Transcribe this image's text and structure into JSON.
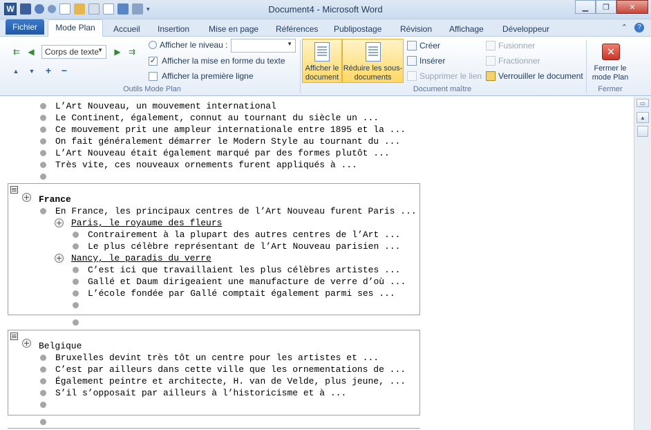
{
  "window": {
    "title": "Document4 - Microsoft Word"
  },
  "tabs": {
    "file": "Fichier",
    "active": "Mode Plan",
    "others": [
      "Accueil",
      "Insertion",
      "Mise en page",
      "Références",
      "Publipostage",
      "Révision",
      "Affichage",
      "Développeur"
    ]
  },
  "ribbon": {
    "outline_tools": {
      "label": "Outils Mode Plan",
      "level_select": "Corps de texte",
      "show_level_label": "Afficher le niveau :",
      "show_text_formatting": "Afficher la mise en forme du texte",
      "show_first_line": "Afficher la première ligne"
    },
    "master_document": {
      "label": "Document maître",
      "show_document": "Afficher le document",
      "collapse_subdocuments": "Réduire les sous-documents",
      "create": "Créer",
      "insert": "Insérer",
      "unlink": "Supprimer le lien",
      "merge": "Fusionner",
      "split": "Fractionner",
      "lock_document": "Verrouiller le document"
    },
    "close": {
      "label": "Fermer",
      "close_outline": "Fermer le mode Plan"
    }
  },
  "document": {
    "intro": [
      "L’Art Nouveau, un mouvement international",
      "Le Continent, également, connut au tournant du siècle un ...",
      "Ce mouvement prit une ampleur internationale entre 1895 et la ...",
      "On fait généralement démarrer le Modern Style au tournant du ...",
      "L’Art Nouveau était également marqué par des formes plutôt ...",
      "Très vite, ces nouveaux ornements furent appliqués à ..."
    ],
    "france": {
      "heading": "France",
      "intro": "En France, les principaux centres de l’Art Nouveau furent Paris ...",
      "paris": {
        "heading": "Paris, le royaume des fleurs",
        "items": [
          "Contrairement à la plupart des autres centres de l’Art ...",
          "Le plus célèbre représentant de l’Art Nouveau parisien ..."
        ]
      },
      "nancy": {
        "heading": "Nancy, le paradis du verre",
        "items": [
          "C’est ici que travaillaient les plus célèbres artistes ...",
          "Gallé et Daum dirigeaient une manufacture de verre d’où ...",
          "L’école fondée par Gallé comptait également parmi ses ..."
        ]
      }
    },
    "belgique": {
      "heading": "Belgique",
      "items": [
        "Bruxelles devint très tôt un centre pour les artistes et ...",
        "C’est par ailleurs dans cette ville que les ornementations de ...",
        "Également peintre et architecte, H. van de Velde, plus jeune, ...",
        "S’il s’opposait par ailleurs à l’historicisme et à ..."
      ]
    }
  }
}
